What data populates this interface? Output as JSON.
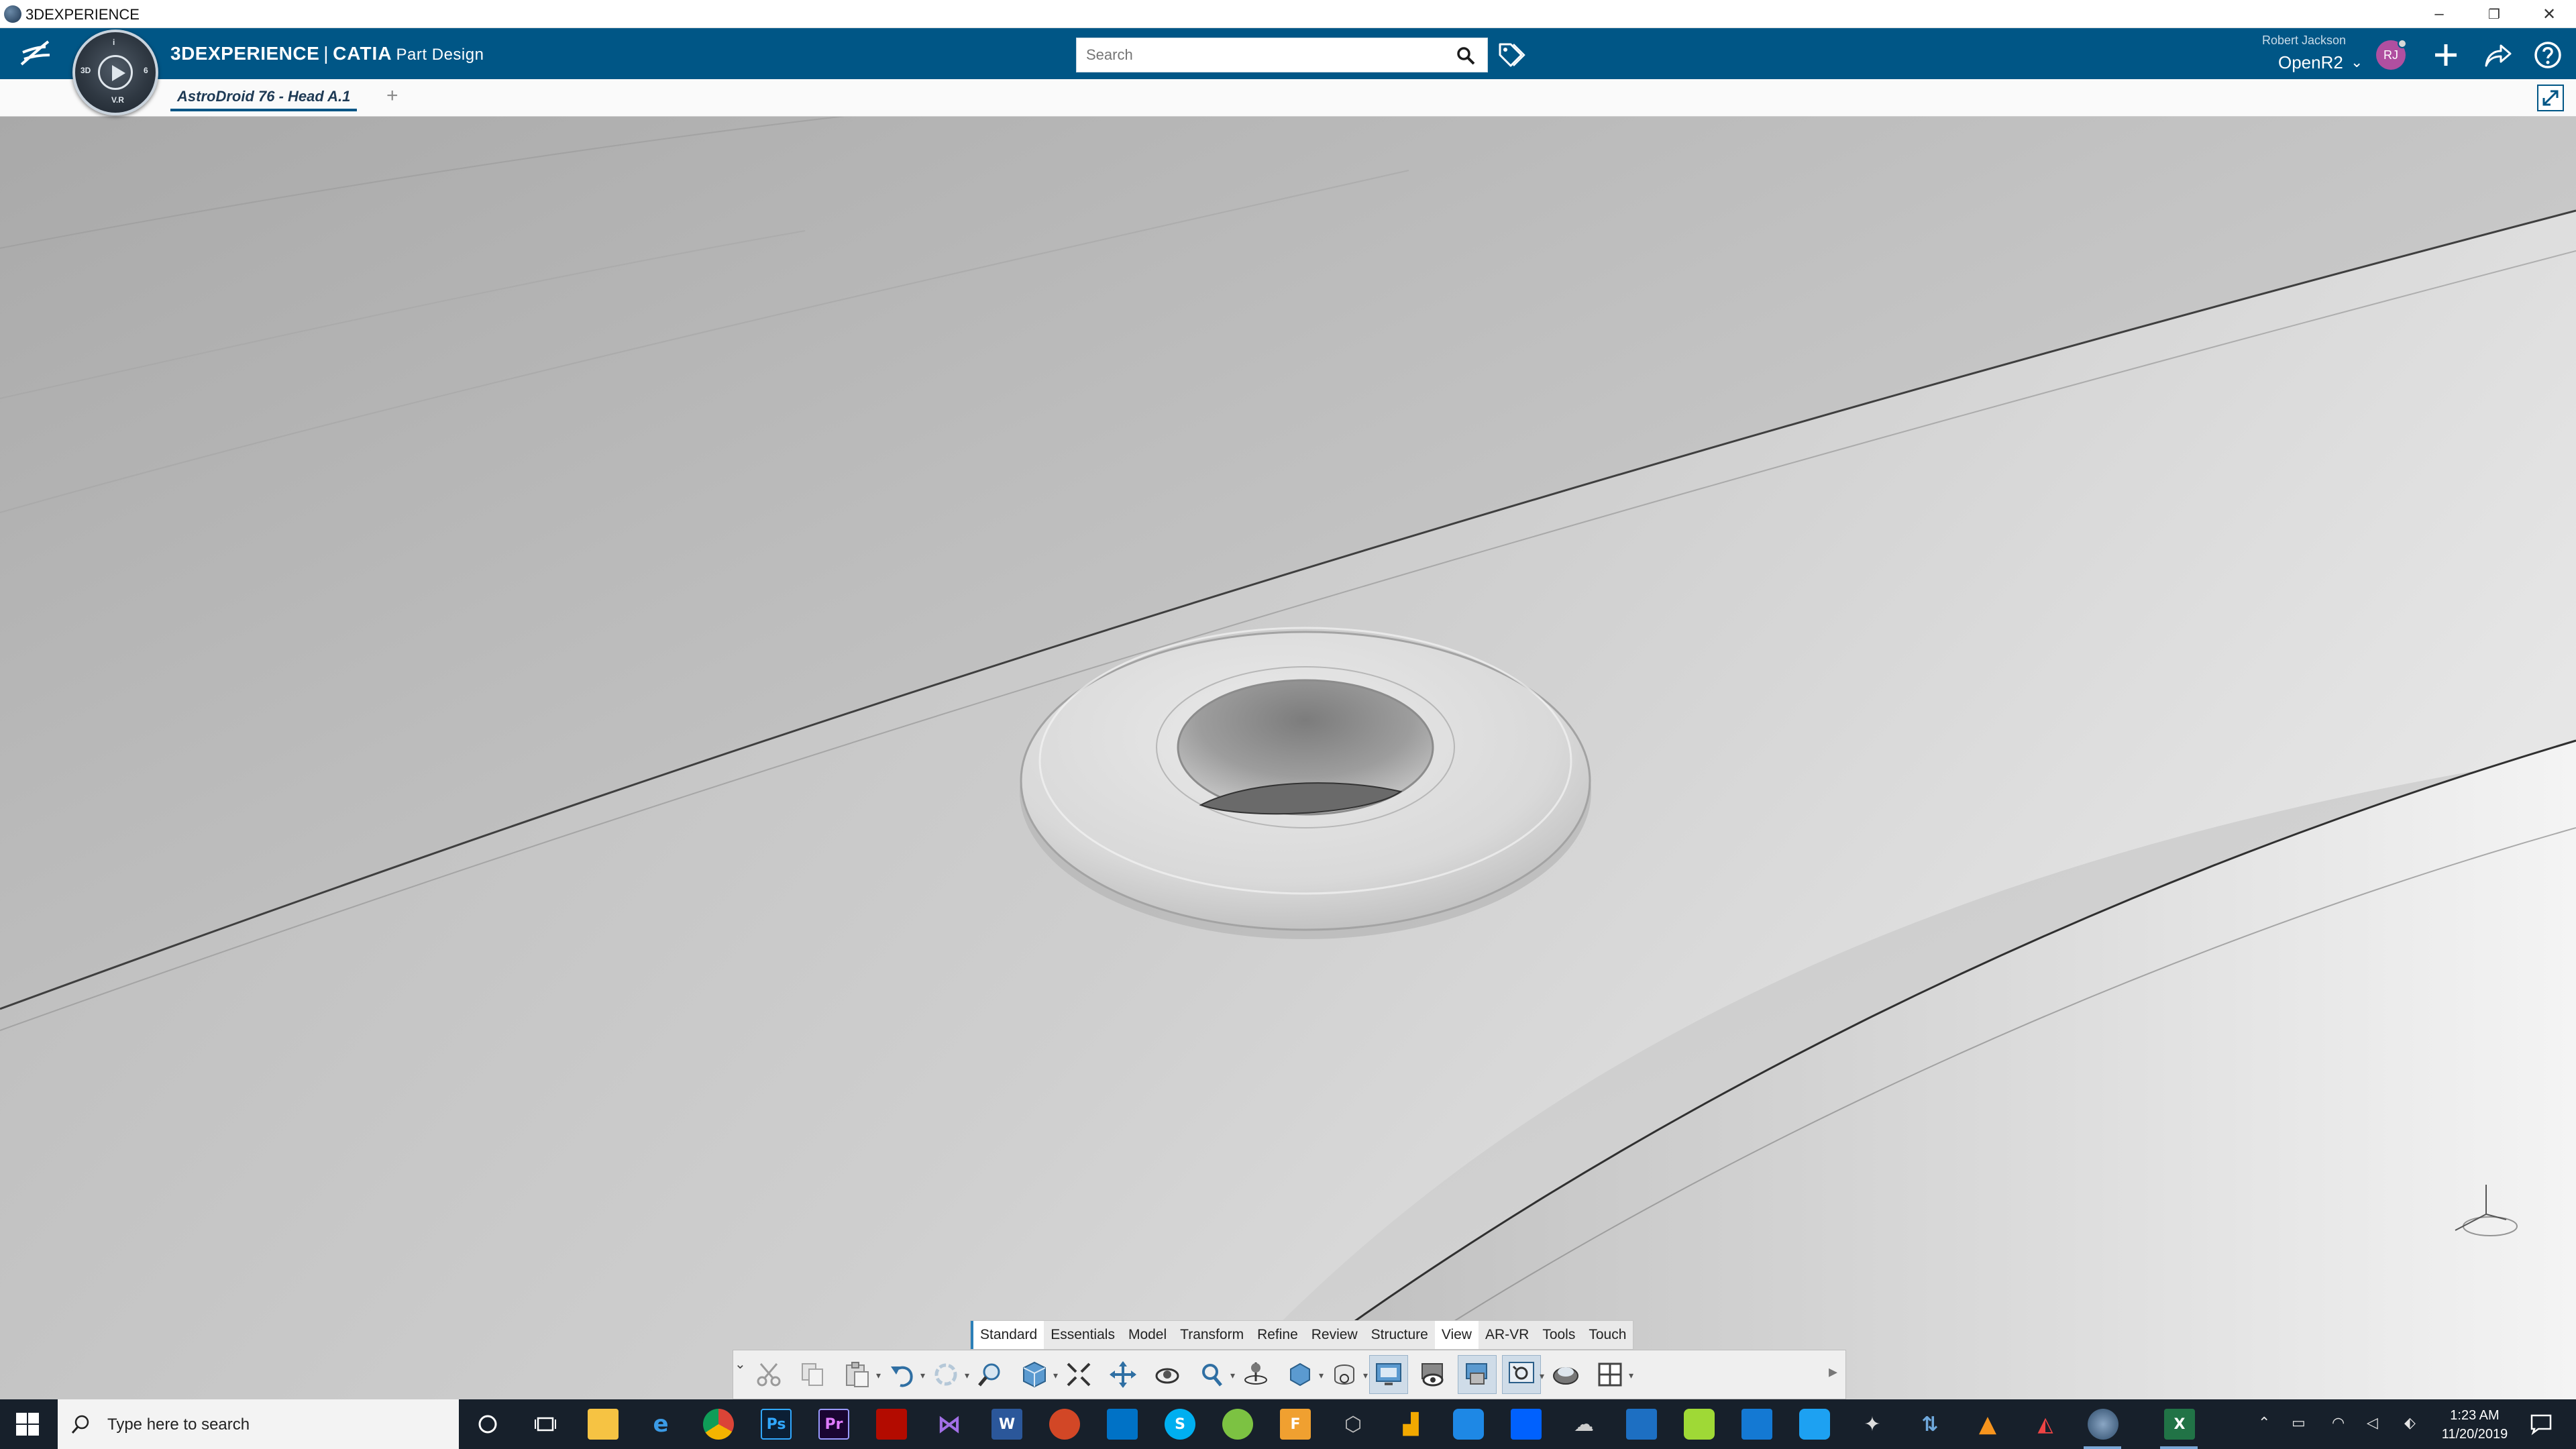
{
  "window": {
    "title": "3DEXPERIENCE",
    "minimize": "–",
    "restore": "❐",
    "close": "✕"
  },
  "header": {
    "brand_platform": "3DEXPERIENCE",
    "brand_separator": "|",
    "brand_app": "CATIA",
    "brand_role": "Part Design",
    "search_placeholder": "Search",
    "user_name": "Robert Jackson",
    "tenant": "OpenR2",
    "avatar_initials": "RJ",
    "compass_quadrants": [
      "3D",
      "V.R",
      "i",
      "6"
    ],
    "icons": [
      "search-icon",
      "tag-icon",
      "add-icon",
      "share-icon",
      "help-icon"
    ]
  },
  "tabs": {
    "active_document": "AstroDroid 76 - Head A.1",
    "add_label": "+"
  },
  "action_bar": {
    "sections": [
      "Standard",
      "Essentials",
      "Model",
      "Transform",
      "Refine",
      "Review",
      "Structure",
      "View",
      "AR-VR",
      "Tools",
      "Touch"
    ],
    "active_section": "Standard",
    "highlighted_section": "View",
    "tools": [
      "cut-icon",
      "copy-icon",
      "paste-icon",
      "undo-icon",
      "update-icon",
      "zoom-icon",
      "view-cube-icon",
      "fit-all-icon",
      "pan-icon",
      "rotate-icon",
      "zoom-area-icon",
      "look-at-icon",
      "view-mode-icon",
      "render-style-icon",
      "shading-icon",
      "hide-show-icon",
      "sectioning-icon",
      "capture-icon",
      "ambience-icon",
      "multi-view-icon"
    ]
  },
  "taskbar": {
    "search_placeholder": "Type here to search",
    "time": "1:23 AM",
    "date": "11/20/2019",
    "apps": [
      "Ps",
      "Pr",
      "W",
      "S",
      "F",
      "X"
    ]
  },
  "colors": {
    "header_blue": "#005686",
    "taskbar": "#17202b",
    "viewport_background": "#bdbdbd"
  }
}
